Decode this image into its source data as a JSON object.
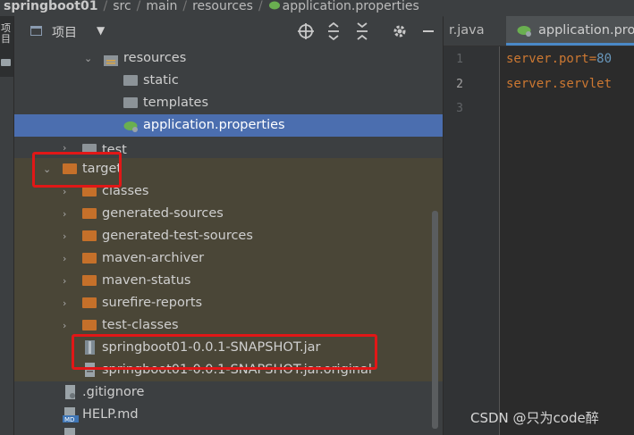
{
  "breadcrumb": {
    "items": [
      "springboot01",
      "src",
      "main",
      "resources",
      "application.properties"
    ]
  },
  "side_strip": {
    "label": "项目"
  },
  "project_panel": {
    "title": "项目",
    "toolbar_icons": [
      "target-icon",
      "expand-all-icon",
      "collapse-all-icon",
      "gear-icon",
      "minimize-icon"
    ]
  },
  "tree": {
    "resources": "resources",
    "static": "static",
    "templates": "templates",
    "application_properties": "application.properties",
    "test": "test",
    "target": "target",
    "classes": "classes",
    "generated_sources": "generated-sources",
    "generated_test_sources": "generated-test-sources",
    "maven_archiver": "maven-archiver",
    "maven_status": "maven-status",
    "surefire_reports": "surefire-reports",
    "test_classes": "test-classes",
    "jar": "springboot01-0.0.1-SNAPSHOT.jar",
    "jar_original": "springboot01-0.0.1-SNAPSHOT.jar.original",
    "gitignore": ".gitignore",
    "help_md": "HELP.md"
  },
  "editor": {
    "tabs": [
      {
        "label": "r.java"
      },
      {
        "label": "application.pro"
      }
    ],
    "line_numbers": [
      "1",
      "2",
      "3"
    ],
    "lines": [
      {
        "key": "server.port=",
        "value": "80"
      },
      {
        "key": "server.servlet",
        "value": ""
      }
    ]
  },
  "colors": {
    "selection": "#4b6eaf",
    "target_tint": "#4a4637",
    "highlight_box": "#e11717",
    "folder_orange": "#c5702a",
    "keyword": "#cc7832"
  },
  "watermark": "CSDN @只为code醉"
}
